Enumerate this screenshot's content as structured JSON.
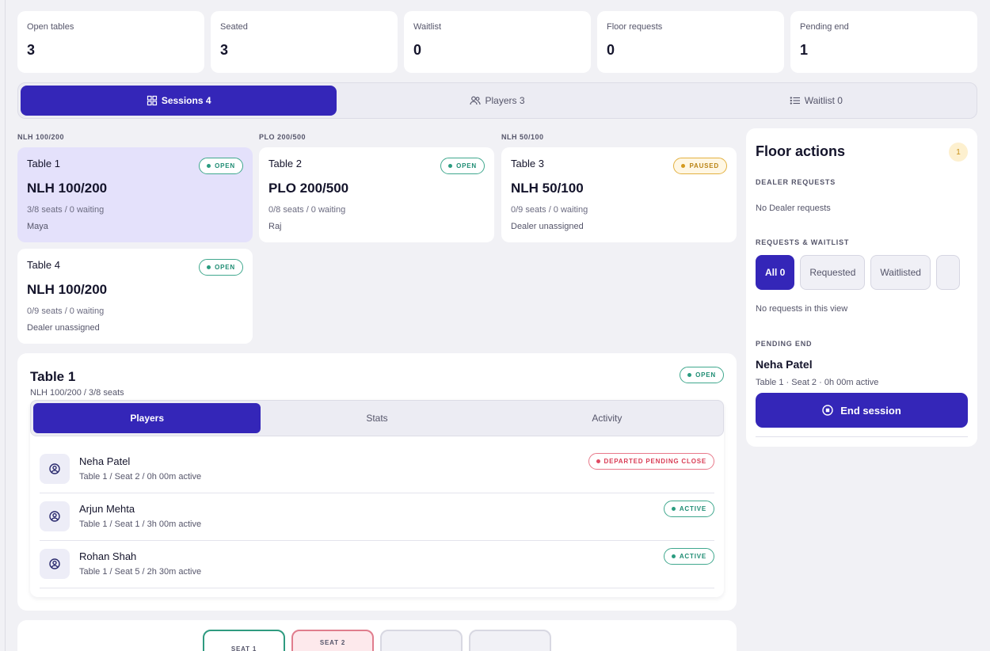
{
  "stats": [
    {
      "label": "Open tables",
      "value": "3"
    },
    {
      "label": "Seated",
      "value": "3"
    },
    {
      "label": "Waitlist",
      "value": "0"
    },
    {
      "label": "Floor requests",
      "value": "0"
    },
    {
      "label": "Pending end",
      "value": "1"
    }
  ],
  "main_tabs": [
    {
      "label": "Sessions 4",
      "icon": "grid-icon",
      "active": true
    },
    {
      "label": "Players 3",
      "icon": "users-icon",
      "active": false
    },
    {
      "label": "Waitlist 0",
      "icon": "list-icon",
      "active": false
    }
  ],
  "groups": [
    "NLH 100/200",
    "PLO 200/500",
    "NLH 50/100"
  ],
  "tables": [
    {
      "name": "Table 1",
      "game": "NLH 100/200",
      "seats": "3/8 seats / 0 waiting",
      "dealer": "Maya",
      "status": "OPEN",
      "selected": true
    },
    {
      "name": "Table 2",
      "game": "PLO 200/500",
      "seats": "0/8 seats / 0 waiting",
      "dealer": "Raj",
      "status": "OPEN"
    },
    {
      "name": "Table 3",
      "game": "NLH 50/100",
      "seats": "0/9 seats / 0 waiting",
      "dealer": "Dealer unassigned",
      "status": "PAUSED"
    },
    {
      "name": "Table 4",
      "game": "NLH 100/200",
      "seats": "0/9 seats / 0 waiting",
      "dealer": "Dealer unassigned",
      "status": "OPEN"
    }
  ],
  "detail": {
    "title": "Table 1",
    "subtitle": "NLH 100/200 / 3/8 seats",
    "status": "OPEN",
    "tabs": [
      "Players",
      "Stats",
      "Activity"
    ],
    "players": [
      {
        "name": "Neha Patel",
        "meta": "Table 1 / Seat 2 / 0h 00m active",
        "status": "DEPARTED PENDING CLOSE"
      },
      {
        "name": "Arjun Mehta",
        "meta": "Table 1 / Seat 1 / 3h 00m active",
        "status": "ACTIVE"
      },
      {
        "name": "Rohan Shah",
        "meta": "Table 1 / Seat 5 / 2h 30m active",
        "status": "ACTIVE"
      }
    ]
  },
  "floor": {
    "title": "Floor actions",
    "count": "1",
    "dealer_requests_heading": "DEALER REQUESTS",
    "dealer_requests_empty": "No Dealer requests",
    "requests_heading": "REQUESTS & WAITLIST",
    "chips": [
      "All 0",
      "Requested",
      "Waitlisted"
    ],
    "requests_empty": "No requests in this view",
    "pending_heading": "PENDING END",
    "pending_name": "Neha Patel",
    "pending_meta": "Table 1 · Seat 2 · 0h 00m active",
    "end_button": "End session"
  },
  "seats": [
    "SEAT 1",
    "SEAT 2"
  ],
  "colors": {
    "accent": "#3426b8",
    "open": "#2b9c80",
    "paused": "#d49a1f",
    "departed": "#e04a62"
  }
}
